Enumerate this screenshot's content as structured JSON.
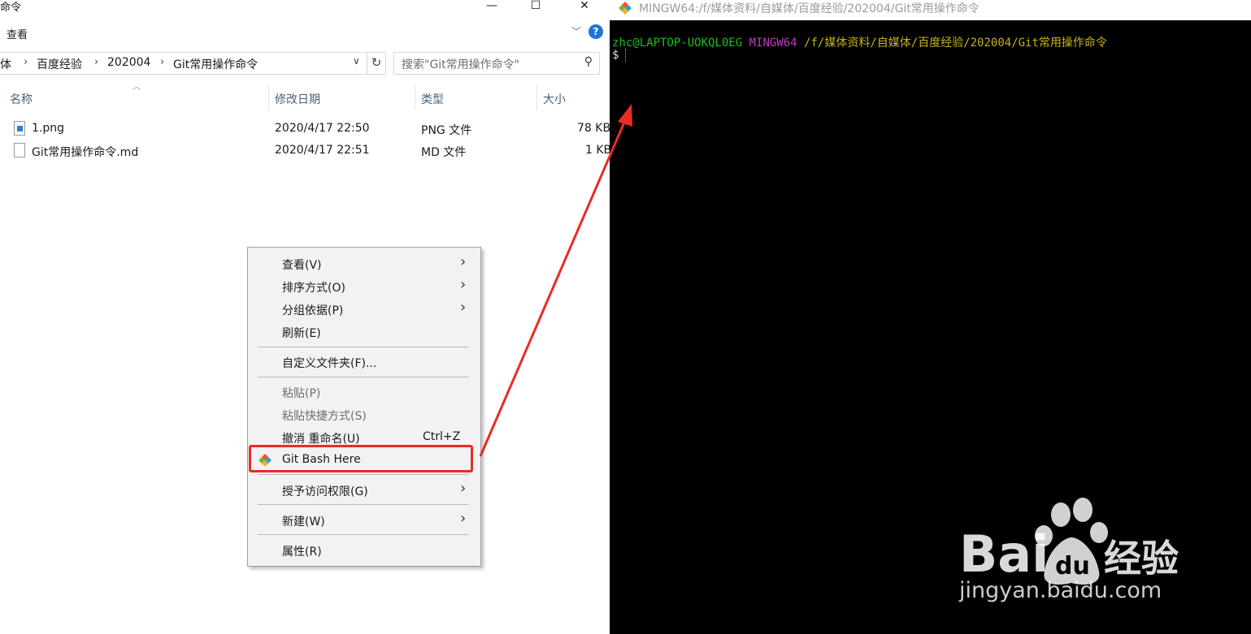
{
  "explorer": {
    "window_title": "命令",
    "ribbon_tab": "查看",
    "window_buttons": {
      "minimize": "—",
      "maximize": "☐",
      "close": "✕"
    },
    "breadcrumb": [
      "体",
      "百度经验",
      "202004",
      "Git常用操作命令"
    ],
    "search_placeholder": "搜索\"Git常用操作命令\"",
    "columns": {
      "name": "名称",
      "modified": "修改日期",
      "type": "类型",
      "size": "大小"
    },
    "files": [
      {
        "name": "1.png",
        "modified": "2020/4/17 22:50",
        "type": "PNG 文件",
        "size": "78 KB",
        "icon": "image-file-icon"
      },
      {
        "name": "Git常用操作命令.md",
        "modified": "2020/4/17 22:51",
        "type": "MD 文件",
        "size": "1 KB",
        "icon": "document-file-icon"
      }
    ]
  },
  "context_menu": {
    "items": [
      {
        "label": "查看(V)",
        "submenu": true
      },
      {
        "label": "排序方式(O)",
        "submenu": true
      },
      {
        "label": "分组依据(P)",
        "submenu": true
      },
      {
        "label": "刷新(E)"
      },
      {
        "label": "自定义文件夹(F)..."
      },
      {
        "label": "粘贴(P)",
        "disabled": true
      },
      {
        "label": "粘贴快捷方式(S)",
        "disabled": true
      },
      {
        "label": "撤消 重命名(U)",
        "shortcut": "Ctrl+Z"
      },
      {
        "label": "Git Bash Here",
        "highlighted": true
      },
      {
        "label": "授予访问权限(G)",
        "submenu": true
      },
      {
        "label": "新建(W)",
        "submenu": true
      },
      {
        "label": "属性(R)"
      }
    ]
  },
  "terminal": {
    "title": "MINGW64:/f/媒体资料/自媒体/百度经验/202004/Git常用操作命令",
    "user_host": "zhc@LAPTOP-UOKQL0EG",
    "env": "MINGW64",
    "path": "/f/媒体资料/自媒体/百度经验/202004/Git常用操作命令",
    "prompt": "$"
  },
  "watermark": {
    "text": "jingyan.baidu.com"
  },
  "colors": {
    "highlight": "#ea2b26",
    "terminal_user": "#18c01e",
    "terminal_env": "#c239c2",
    "terminal_path": "#c6b21b"
  }
}
